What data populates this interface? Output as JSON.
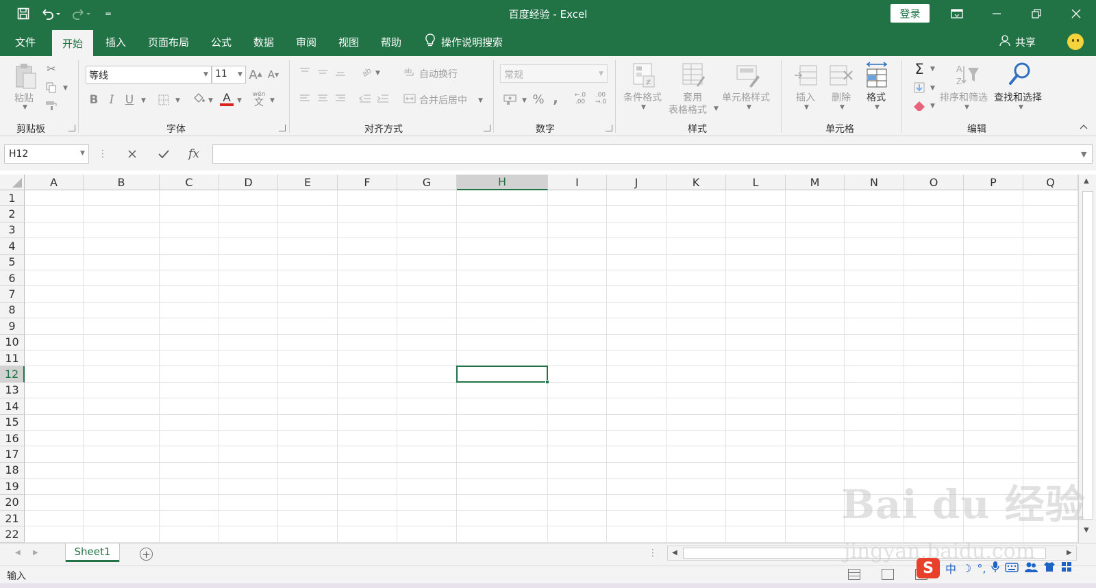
{
  "title_bar": {
    "document_title": "百度经验  -  Excel",
    "login_label": "登录",
    "qat_more": "="
  },
  "menu": {
    "tabs": [
      "文件",
      "开始",
      "插入",
      "页面布局",
      "公式",
      "数据",
      "审阅",
      "视图",
      "帮助"
    ],
    "active_tab": "开始",
    "tell_me": "操作说明搜索",
    "share": "共享"
  },
  "ribbon": {
    "clipboard": {
      "group": "剪贴板",
      "paste": "粘贴"
    },
    "font": {
      "group": "字体",
      "font_name": "等线",
      "font_size": "11",
      "bold": "B",
      "italic": "I",
      "underline": "U",
      "grow": "A",
      "shrink": "A",
      "phonetic_top": "wén",
      "phonetic_bottom": "文"
    },
    "alignment": {
      "group": "对齐方式",
      "wrap_text": "自动换行",
      "merge_center": "合并后居中"
    },
    "number": {
      "group": "数字",
      "format": "常规",
      "percent": "%",
      "comma": ",",
      "inc_decimal": "←.0 .00",
      "dec_decimal": ".00 →.0"
    },
    "styles": {
      "group": "样式",
      "conditional": "条件格式",
      "table_line1": "套用",
      "table_line2": "表格格式",
      "cell_styles": "单元格样式"
    },
    "cells": {
      "group": "单元格",
      "insert": "插入",
      "delete": "删除",
      "format": "格式"
    },
    "editing": {
      "group": "编辑",
      "autosum": "Σ",
      "sort_filter": "排序和筛选",
      "find_select": "查找和选择"
    }
  },
  "formula_bar": {
    "name_box": "H12",
    "fx": "fx",
    "content": ""
  },
  "grid": {
    "columns": [
      "A",
      "B",
      "C",
      "D",
      "E",
      "F",
      "G",
      "H",
      "I",
      "J",
      "K",
      "L",
      "M",
      "N",
      "O",
      "P",
      "Q"
    ],
    "rows": [
      "1",
      "2",
      "3",
      "4",
      "5",
      "6",
      "7",
      "8",
      "9",
      "10",
      "11",
      "12",
      "13",
      "14",
      "15",
      "16",
      "17",
      "18",
      "19",
      "20",
      "21",
      "22"
    ],
    "selected_column": "H",
    "selected_row": "12"
  },
  "sheets": {
    "tabs": [
      "Sheet1"
    ],
    "add": "+"
  },
  "status_bar": {
    "mode": "输入"
  },
  "ime": {
    "logo": "S",
    "lang": "中"
  },
  "watermark": {
    "main": "Bai du 经验",
    "sub": "jingyan.baidu.com"
  },
  "colors": {
    "accent": "#217346",
    "ribbon_bg": "#f3f3f3"
  }
}
